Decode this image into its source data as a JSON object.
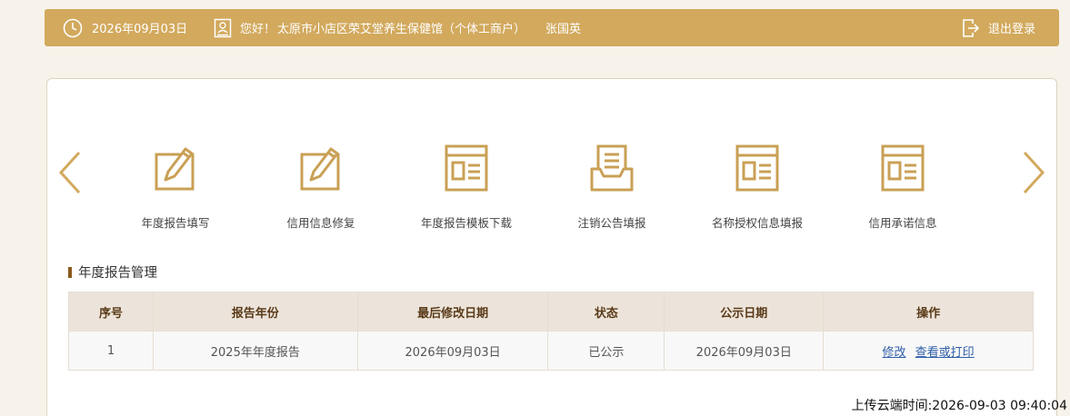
{
  "colors": {
    "gold": "#d2a95d",
    "brown": "#8a5a1c",
    "link": "#2f5ea8"
  },
  "header": {
    "date": "2026年09月03日",
    "greeting": "您好！",
    "company": "太原市小店区荣艾堂养生保健馆（个体工商户）",
    "user": "张国英",
    "logout": "退出登录"
  },
  "menu": [
    {
      "label": "年度报告填写",
      "icon": "pencil-edit-icon"
    },
    {
      "label": "信用信息修复",
      "icon": "pencil-edit-icon"
    },
    {
      "label": "年度报告模板下载",
      "icon": "document-template-icon"
    },
    {
      "label": "注销公告填报",
      "icon": "inbox-document-icon"
    },
    {
      "label": "名称授权信息填报",
      "icon": "document-template-icon"
    },
    {
      "label": "信用承诺信息",
      "icon": "document-template-icon"
    }
  ],
  "section": {
    "title": "年度报告管理"
  },
  "table": {
    "headers": [
      "序号",
      "报告年份",
      "最后修改日期",
      "状态",
      "公示日期",
      "操作"
    ],
    "rows": [
      {
        "index": "1",
        "year": "2025年年度报告",
        "modified": "2026年09月03日",
        "status": "已公示",
        "published": "2026年09月03日",
        "actions": [
          "修改",
          "查看或打印"
        ]
      }
    ]
  },
  "footer": {
    "upload_time": "上传云端时间:2026-09-03 09:40:04"
  }
}
